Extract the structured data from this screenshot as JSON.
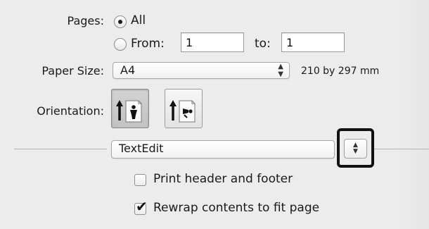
{
  "pages": {
    "label": "Pages:",
    "all_label": "All",
    "from_label": "From:",
    "from_value": "1",
    "to_label": "to:",
    "to_value": "1",
    "selected": "All"
  },
  "paper_size": {
    "label": "Paper Size:",
    "value": "A4",
    "dimensions": "210 by 297 mm"
  },
  "orientation": {
    "label": "Orientation:",
    "options": [
      "portrait",
      "landscape"
    ],
    "selected": "portrait"
  },
  "app_section": {
    "value": "TextEdit"
  },
  "options": {
    "print_header_footer_label": "Print header and footer",
    "print_header_footer_checked": false,
    "rewrap_label": "Rewrap contents to fit page",
    "rewrap_checked": true,
    "check_glyph": "✔"
  },
  "glyphs": {
    "popup_arrows_up": "▲",
    "popup_arrows_down": "▼"
  },
  "colors": {
    "background": "#ececec",
    "highlight": "#111111"
  }
}
